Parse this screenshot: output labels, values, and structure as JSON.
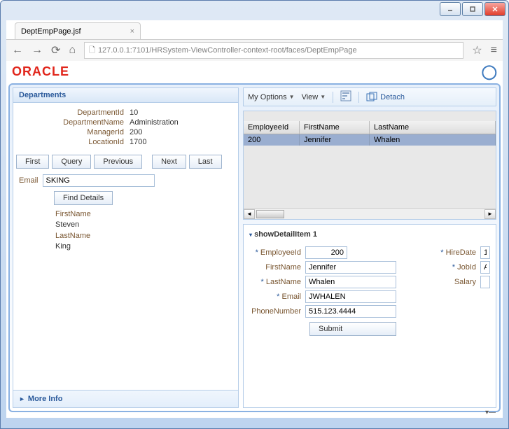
{
  "window": {
    "tab_title": "DeptEmpPage.jsf",
    "url_display": "127.0.0.1:7101/HRSystem-ViewController-context-root/faces/DeptEmpPage"
  },
  "brand": {
    "logo_text": "ORACLE"
  },
  "departments": {
    "panel_title": "Departments",
    "labels": {
      "dept_id": "DepartmentId",
      "dept_name": "DepartmentName",
      "manager_id": "ManagerId",
      "location_id": "LocationId"
    },
    "values": {
      "dept_id": "10",
      "dept_name": "Administration",
      "manager_id": "200",
      "location_id": "1700"
    },
    "nav_buttons": {
      "first": "First",
      "query": "Query",
      "previous": "Previous",
      "next": "Next",
      "last": "Last"
    },
    "email_label": "Email",
    "email_value": "SKING",
    "find_details_btn": "Find Details",
    "result": {
      "first_name_label": "FirstName",
      "first_name_value": "Steven",
      "last_name_label": "LastName",
      "last_name_value": "King"
    },
    "more_info": "More Info"
  },
  "toolbar": {
    "my_options": "My Options",
    "view": "View",
    "detach": "Detach"
  },
  "table": {
    "headers": {
      "emp_id": "EmployeeId",
      "first_name": "FirstName",
      "last_name": "LastName"
    },
    "rows": [
      {
        "emp_id": "200",
        "first_name": "Jennifer",
        "last_name": "Whalen"
      }
    ]
  },
  "detail": {
    "title": "showDetailItem 1",
    "labels": {
      "employee_id": "EmployeeId",
      "first_name": "FirstName",
      "last_name": "LastName",
      "email": "Email",
      "phone": "PhoneNumber",
      "hire_date": "HireDate",
      "job_id": "JobId",
      "salary": "Salary"
    },
    "values": {
      "employee_id": "200",
      "first_name": "Jennifer",
      "last_name": "Whalen",
      "email": "JWHALEN",
      "phone": "515.123.4444",
      "hire_date": "1",
      "job_id": "A",
      "salary": ""
    },
    "submit": "Submit"
  }
}
